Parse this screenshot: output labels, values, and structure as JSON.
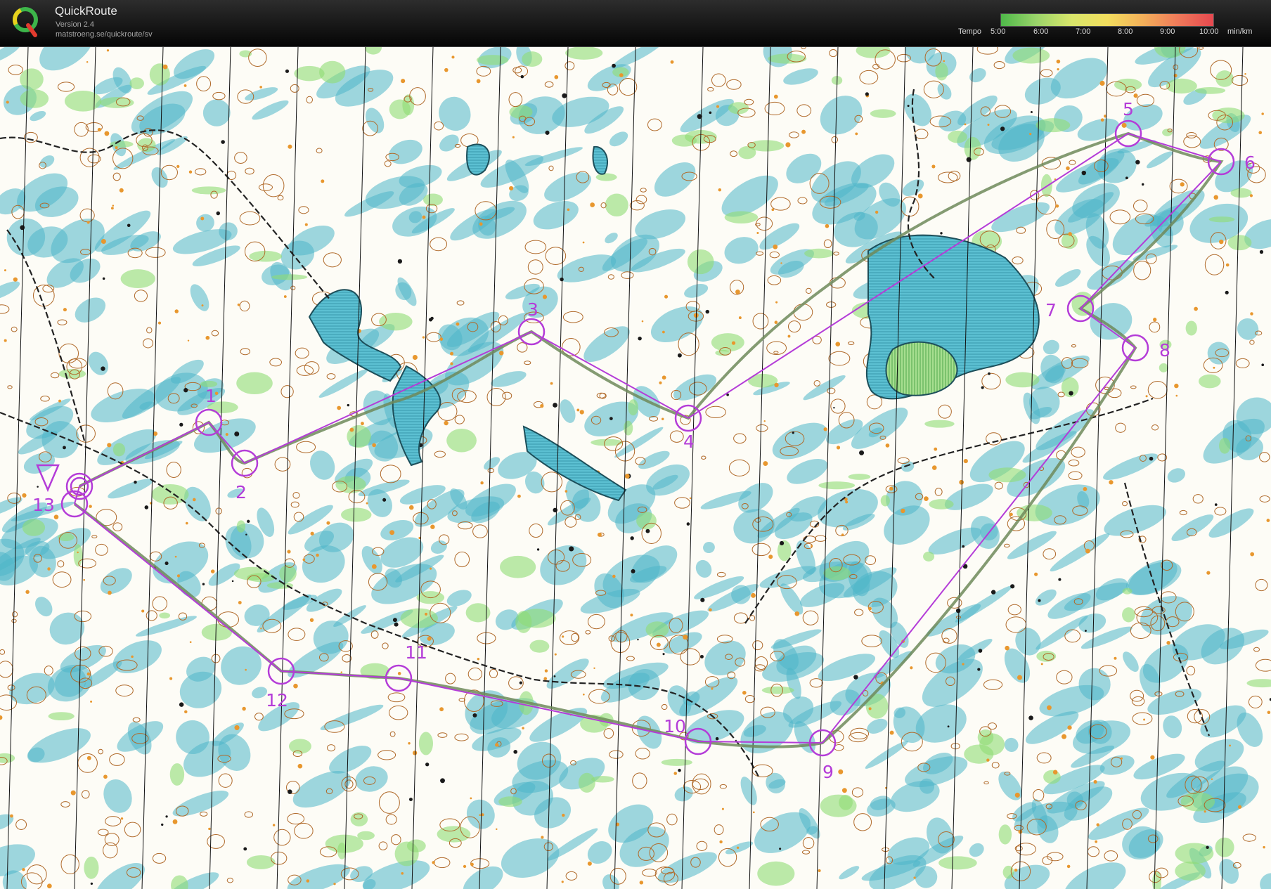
{
  "app": {
    "name": "QuickRoute",
    "version": "Version 2.4",
    "url": "matstroeng.se/quickroute/sv"
  },
  "legend": {
    "label": "Tempo",
    "ticks": [
      "5:00",
      "6:00",
      "7:00",
      "8:00",
      "9:00",
      "10:00"
    ],
    "unit": "min/km"
  },
  "course": {
    "controls": [
      {
        "label": "1"
      },
      {
        "label": "2"
      },
      {
        "label": "3"
      },
      {
        "label": "4"
      },
      {
        "label": "5"
      },
      {
        "label": "6"
      },
      {
        "label": "7"
      },
      {
        "label": "8"
      },
      {
        "label": "9"
      },
      {
        "label": "10"
      },
      {
        "label": "11"
      },
      {
        "label": "12"
      },
      {
        "label": "13"
      }
    ]
  },
  "colors": {
    "course": "#b43cd8",
    "route": "#6e8a5a",
    "water": "#4fb7c9",
    "contour": "#b06a2a",
    "vegetation": "#8fdc74"
  }
}
